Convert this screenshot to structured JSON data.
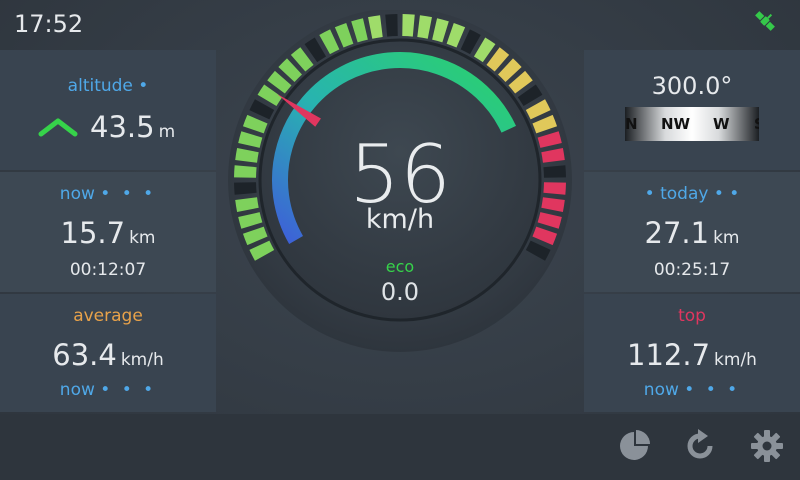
{
  "status": {
    "time": "17:52"
  },
  "left": {
    "altitude": {
      "label": "altitude •",
      "value": "43.5",
      "unit": "m"
    },
    "now": {
      "label": "now",
      "dots": "• • •",
      "distance": "15.7",
      "unit": "km",
      "time": "00:12:07"
    },
    "average": {
      "label": "average",
      "value": "63.4",
      "unit": "km/h",
      "footer": "now",
      "dots": "• • •"
    }
  },
  "right": {
    "heading": {
      "value": "300.0°",
      "compass": [
        "N",
        "NW",
        "W",
        "S"
      ]
    },
    "today": {
      "label": "• today • •",
      "distance": "27.1",
      "unit": "km",
      "time": "00:25:17"
    },
    "top": {
      "label": "top",
      "value": "112.7",
      "unit": "km/h",
      "footer": "now",
      "dots": "• • •"
    }
  },
  "gauge": {
    "speed": "56",
    "unit": "km/h",
    "eco_label": "eco",
    "eco_value": "0.0"
  },
  "colors": {
    "accent": "#4fa8e8",
    "eco": "#36d34a",
    "average": "#e8a24a",
    "top": "#e0365f"
  },
  "icons": [
    "satellite-icon",
    "pie-chart-icon",
    "refresh-icon",
    "gear-icon"
  ]
}
